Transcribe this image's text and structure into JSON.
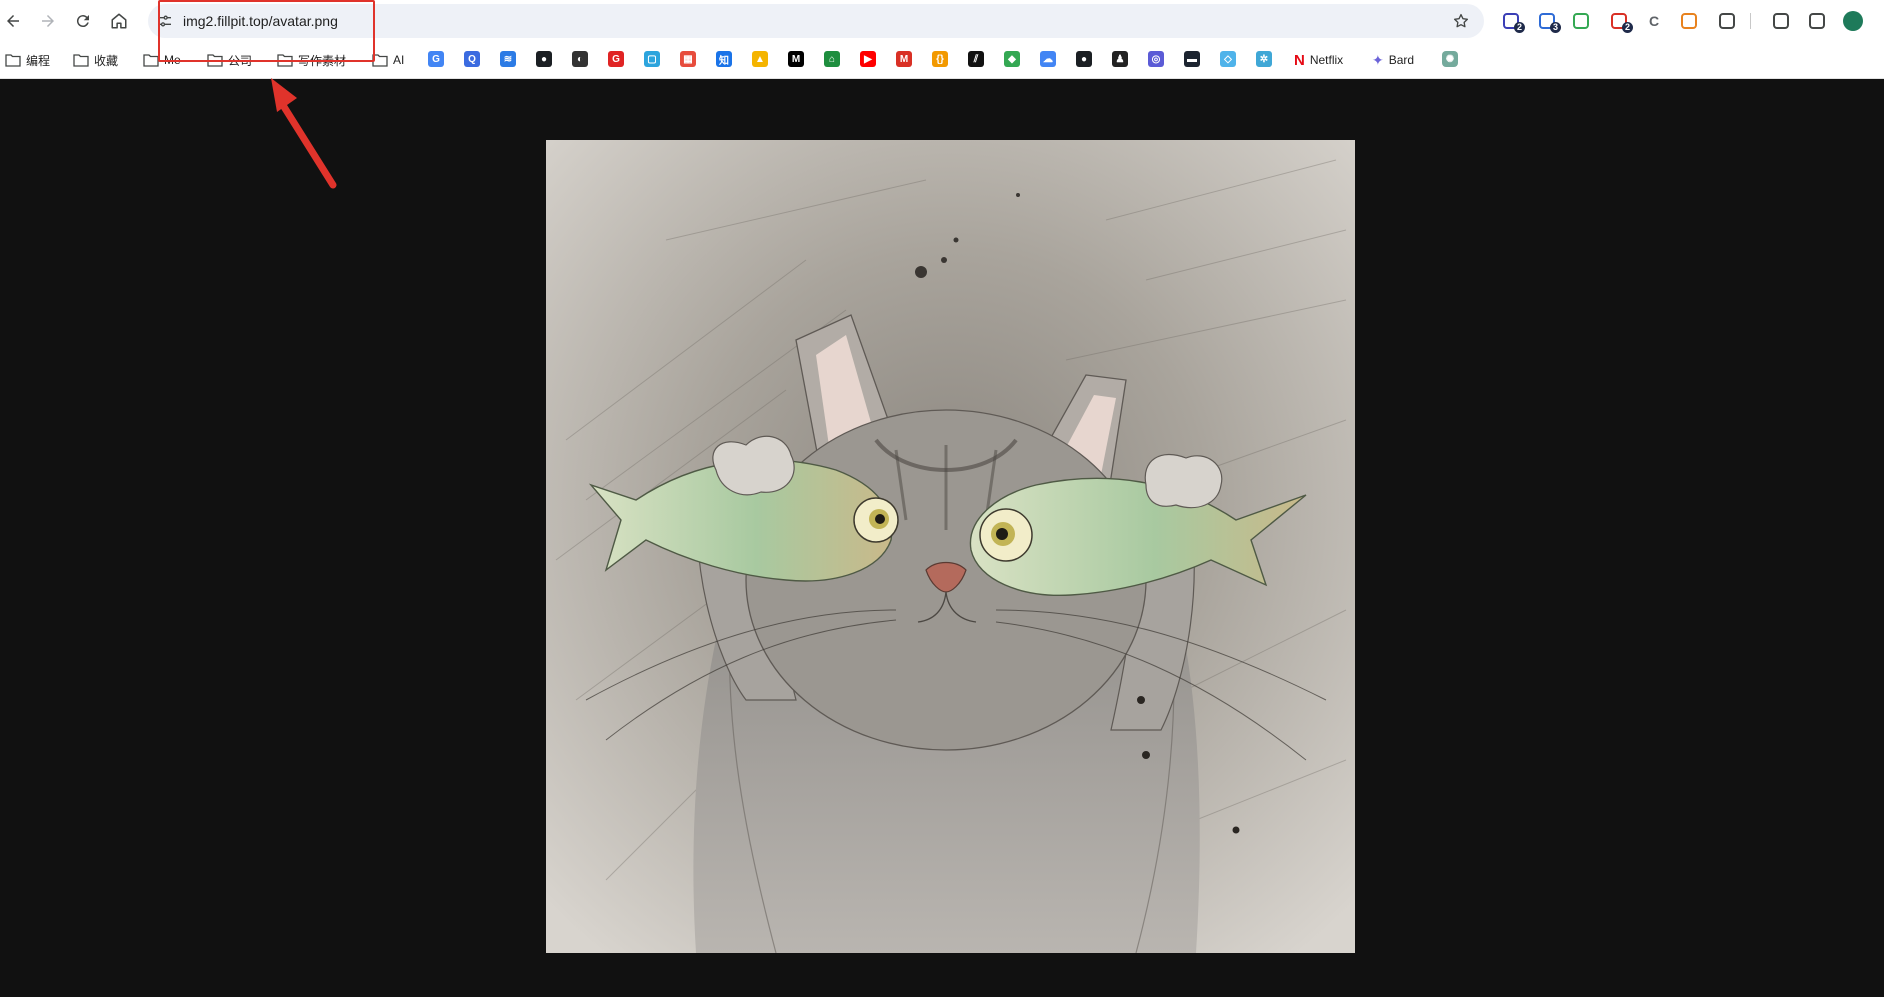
{
  "browser": {
    "url": "img2.fillpit.top/avatar.png",
    "nav_icons": [
      "back-icon",
      "forward-icon",
      "reload-icon",
      "home-icon"
    ],
    "extensions": [
      {
        "name": "ext-stack-icon",
        "badge": "2",
        "color": "#3b3fb6"
      },
      {
        "name": "ext-translate-icon",
        "badge": "3",
        "color": "#2e6bd6"
      },
      {
        "name": "ext-shield-icon",
        "badge": "",
        "color": "#34a853"
      },
      {
        "name": "ext-red-icon",
        "badge": "2",
        "color": "#d93025"
      },
      {
        "name": "ext-c-icon",
        "badge": "",
        "color": "#5f6368",
        "letter": "C"
      },
      {
        "name": "metamask-fox-icon",
        "badge": "",
        "color": "#e8821e"
      },
      {
        "name": "extensions-puzzle-icon",
        "badge": "",
        "color": "#444746"
      },
      {
        "name": "download-icon",
        "badge": "",
        "color": "#444746"
      },
      {
        "name": "side-panel-icon",
        "badge": "",
        "color": "#444746"
      },
      {
        "name": "profile-avatar",
        "badge": "",
        "color": "#1e7a5a"
      }
    ]
  },
  "bookmarks": {
    "folders": [
      "编程",
      "收藏",
      "Me",
      "公司",
      "写作素材",
      "AI"
    ],
    "icons": [
      {
        "name": "google-icon",
        "color": "#4285f4",
        "glyph": "G"
      },
      {
        "name": "search-q-icon",
        "color": "#3b6be0",
        "glyph": "Q"
      },
      {
        "name": "layers-icon",
        "color": "#2c7be5",
        "glyph": "≋"
      },
      {
        "name": "github-icon",
        "color": "#1b1f23",
        "glyph": "●"
      },
      {
        "name": "chatbot-icon",
        "color": "#333333",
        "glyph": "◐"
      },
      {
        "name": "red-g-icon",
        "color": "#e02424",
        "glyph": "G"
      },
      {
        "name": "bilibili-icon",
        "color": "#2ca4dd",
        "glyph": "▢"
      },
      {
        "name": "red-grid-icon",
        "color": "#e74c3c",
        "glyph": "▦"
      },
      {
        "name": "zhihu-icon",
        "color": "#1a73e8",
        "glyph": "知"
      },
      {
        "name": "google-drive-icon",
        "color": "#f4b400",
        "glyph": "▲"
      },
      {
        "name": "medium-icon",
        "color": "#000000",
        "glyph": "M"
      },
      {
        "name": "green-store-icon",
        "color": "#1e8e3e",
        "glyph": "⌂"
      },
      {
        "name": "youtube-icon",
        "color": "#ff0000",
        "glyph": "▶"
      },
      {
        "name": "gmail-icon",
        "color": "#d93025",
        "glyph": "M"
      },
      {
        "name": "code-bracket-icon",
        "color": "#f29900",
        "glyph": "{}"
      },
      {
        "name": "stripes-icon",
        "color": "#111111",
        "glyph": "⫽"
      },
      {
        "name": "maps-icon",
        "color": "#34a853",
        "glyph": "◆"
      },
      {
        "name": "cloud-icon",
        "color": "#4285f4",
        "glyph": "☁"
      },
      {
        "name": "github-icon",
        "color": "#1b1f23",
        "glyph": "●"
      },
      {
        "name": "qq-penguin-icon",
        "color": "#222222",
        "glyph": "♟"
      },
      {
        "name": "purple-app-icon",
        "color": "#5b5bd6",
        "glyph": "◎"
      },
      {
        "name": "dark-box-icon",
        "color": "#1c2430",
        "glyph": "▬"
      },
      {
        "name": "light-blue-icon",
        "color": "#4fb3ea",
        "glyph": "◇"
      },
      {
        "name": "snow-icon",
        "color": "#3fa7d6",
        "glyph": "✲"
      }
    ],
    "netflix": "Netflix",
    "bard": "Bard",
    "last_icon": {
      "name": "chatgpt-icon",
      "color": "#74aa9c"
    }
  },
  "annotation": {
    "highlight_color": "#e0332b"
  },
  "page": {
    "background": "#111111",
    "image_alt": "cat holding two fish over its eyes"
  }
}
